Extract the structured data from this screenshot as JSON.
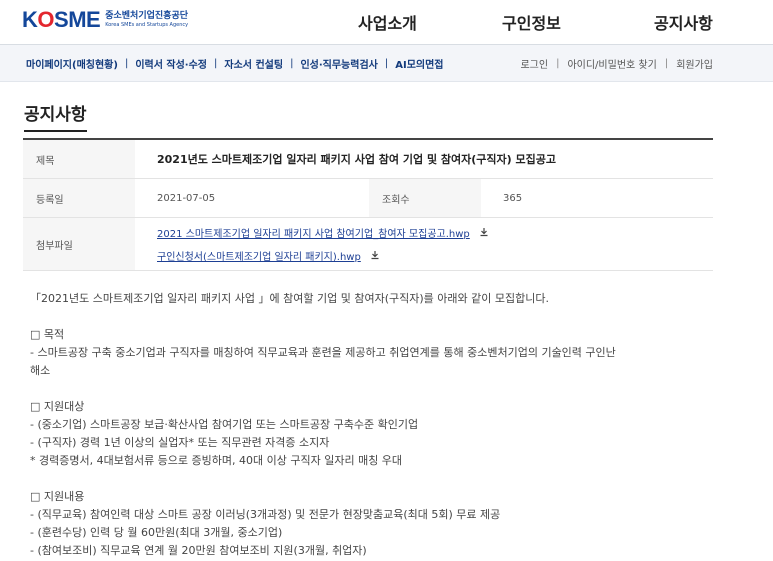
{
  "header": {
    "logo_main": "K",
    "logo_o": "O",
    "logo_rest": "SME",
    "logo_ko": "중소벤처기업진흥공단",
    "logo_en": "Korea SMEs and Startups Agency",
    "nav": [
      "사업소개",
      "구인정보",
      "공지사항"
    ]
  },
  "subnav": {
    "items": [
      "마이페이지(매칭현황)",
      "이력서 작성·수정",
      "자소서 컨설팅",
      "인성·직무능력검사",
      "AI모의면접"
    ],
    "separator": "|"
  },
  "util": {
    "login": "로그인",
    "find": "아이디/비밀번호 찾기",
    "join": "회원가입",
    "separator": "|"
  },
  "page_title": "공지사항",
  "post": {
    "subject_label": "제목",
    "subject": "2021년도 스마트제조기업 일자리 패키지 사업 참여 기업 및 참여자(구직자) 모집공고",
    "date_label": "등록일",
    "date": "2021-07-05",
    "views_label": "조회수",
    "views": "365",
    "files_label": "첨부파일",
    "files": [
      "2021 스마트제조기업 일자리 패키지 사업 참여기업_참여자 모집공고.hwp",
      "구인신청서(스마트제조기업 일자리 패키지).hwp"
    ],
    "download_icon": "download-icon"
  },
  "content": {
    "intro": "「2021년도 스마트제조기업 일자리 패키지 사업 」에 참여할 기업 및 참여자(구직자)를 아래와 같이 모집합니다.",
    "s1_title": "□ 목적",
    "s1_l1": "- 스마트공장 구축 중소기업과 구직자를 매칭하여 직무교육과 훈련을 제공하고 취업연계를 통해 중소벤처기업의 기술인력 구인난",
    "s1_l2": "해소",
    "s2_title": "□ 지원대상",
    "s2_l1": "- (중소기업) 스마트공장 보급·확산사업 참여기업 또는 스마트공장 구축수준 확인기업",
    "s2_l2": "- (구직자) 경력 1년 이상의 실업자* 또는 직무관련 자격증 소지자",
    "s2_l3": "* 경력증명서, 4대보험서류 등으로 증빙하며, 40대 이상 구직자 일자리 매칭 우대",
    "s3_title": "□ 지원내용",
    "s3_l1": "- (직무교육) 참여인력 대상 스마트 공장 이러닝(3개과정) 및 전문가 현장맞춤교육(최대 5회) 무료 제공",
    "s3_l2": "- (훈련수당) 인력 당 월 60만원(최대 3개월, 중소기업)",
    "s3_l3": "- (참여보조비) 직무교육 연계 월 20만원 참여보조비 지원(3개월, 취업자)"
  }
}
